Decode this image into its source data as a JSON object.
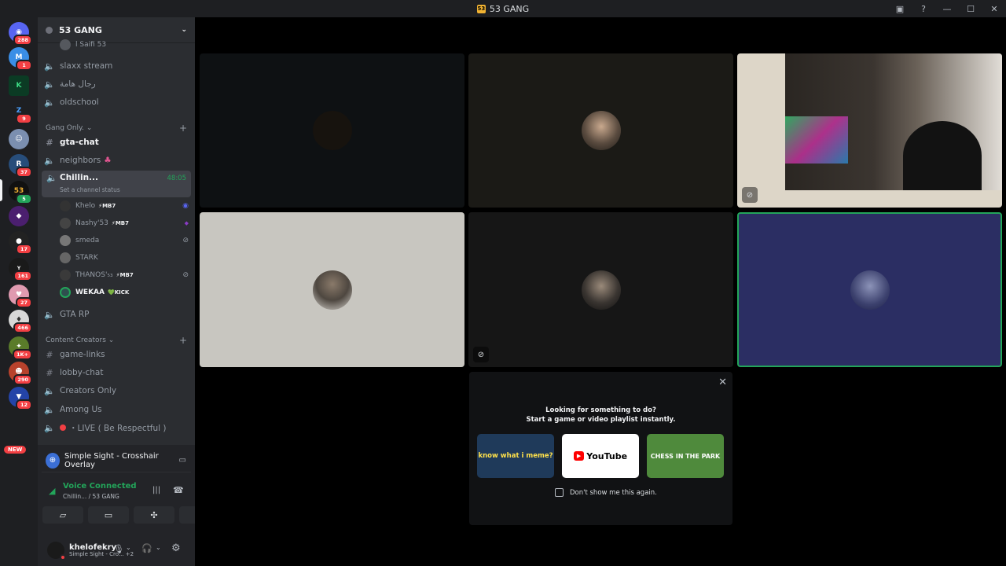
{
  "window": {
    "title": "53 GANG"
  },
  "server": {
    "name": "53 GANG"
  },
  "guild_badges": [
    "288",
    "1",
    "",
    "9",
    "",
    "37",
    "5",
    "",
    "17",
    "161",
    "27",
    "466",
    "1K+",
    "290",
    "12"
  ],
  "new_label": "NEW",
  "channels_top": {
    "partial_user": "ا Saifi 53",
    "items": [
      {
        "name": "slaxx stream",
        "type": "voice"
      },
      {
        "name": "رجال هامة",
        "type": "voice"
      },
      {
        "name": "oldschool",
        "type": "voice"
      }
    ]
  },
  "category_gang": "Gang Only.",
  "gang_channels": [
    {
      "name": "gta-chat",
      "type": "text"
    },
    {
      "name": "neighbors",
      "type": "voice"
    }
  ],
  "active_voice": {
    "name": "Chillin...",
    "timer": "48:05",
    "status": "Set a channel status"
  },
  "voice_users": [
    {
      "name": "Khelo",
      "tag": "⚡MB7"
    },
    {
      "name": "Nashy'53",
      "tag": "⚡MB7"
    },
    {
      "name": "smeda",
      "tag": ""
    },
    {
      "name": "STARK",
      "tag": ""
    },
    {
      "name": "THANOS'₅₃",
      "tag": "⚡MB7"
    },
    {
      "name": "WEKAA",
      "tag": "💚KICK"
    }
  ],
  "gta_rp": "GTA RP",
  "category_creators": "Content Creators",
  "creator_channels": [
    {
      "name": "game-links",
      "type": "text"
    },
    {
      "name": "lobby-chat",
      "type": "text"
    },
    {
      "name": "Creators Only",
      "type": "voice"
    },
    {
      "name": "Among Us",
      "type": "voice"
    },
    {
      "name": "・LIVE ( Be Respectful )",
      "type": "voice"
    }
  ],
  "activity": {
    "name": "Simple Sight - Crosshair Overlay"
  },
  "voice_status": {
    "title": "Voice Connected",
    "sub": "Chillin... / 53 GANG"
  },
  "user": {
    "name": "khelofekry",
    "status": "Simple Sight - Cro...",
    "extra": "+2"
  },
  "promo": {
    "line1": "Looking for something to do?",
    "line2": "Start a game or video playlist instantly.",
    "cards": [
      "know what i meme?",
      "YouTube",
      "CHESS IN THE PARK"
    ],
    "checkbox_label": "Don't show me this again."
  },
  "colors": {
    "accent": "#23a55a",
    "badge": "#f23f43",
    "selected_tile": "#2b2e63"
  }
}
